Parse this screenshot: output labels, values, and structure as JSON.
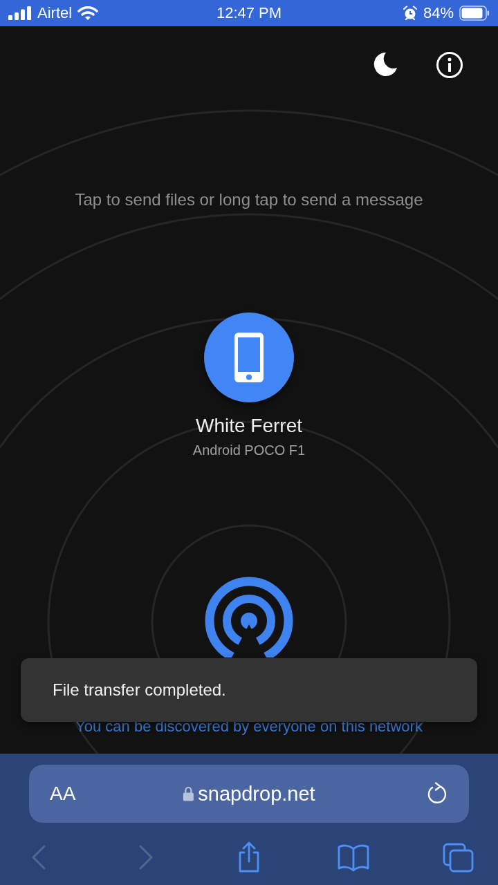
{
  "status_bar": {
    "carrier": "Airtel",
    "time": "12:47 PM",
    "battery": "84%"
  },
  "hint": "Tap to send files or long tap to send a message",
  "peers": [
    {
      "name": "White Ferret",
      "device": "Android POCO F1"
    }
  ],
  "discover_text": "You can be discovered by everyone on this network",
  "toast": {
    "message": "File transfer completed."
  },
  "browser": {
    "text_size": "AA",
    "url": "snapdrop.net",
    "toolbar": [
      {
        "kind": "back",
        "disabled": true
      },
      {
        "kind": "forward",
        "disabled": true
      },
      {
        "kind": "share",
        "disabled": false
      },
      {
        "kind": "bookmarks",
        "disabled": false
      },
      {
        "kind": "tabs",
        "disabled": false
      }
    ]
  }
}
